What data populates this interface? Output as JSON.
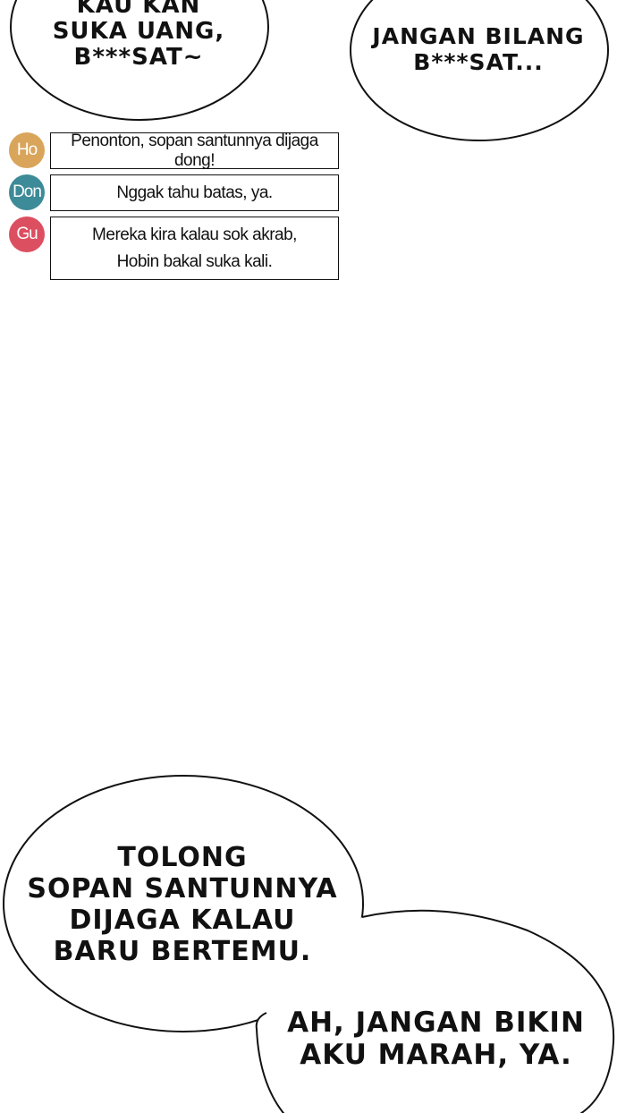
{
  "balloons": {
    "top_left": "KAU KAN\nSUKA UANG,\nB***SAT~",
    "top_right": "JANGAN BILANG\nB***SAT...",
    "bottom_left": "TOLONG\nSOPAN SANTUNNYA\nDIJAGA KALAU\nBARU BERTEMU.",
    "bottom_right": "AH, JANGAN BIKIN\nAKU MARAH, YA."
  },
  "chat": [
    {
      "initials": "Ho",
      "color": "#D9A55B",
      "message": "Penonton, sopan santunnya dijaga dong!"
    },
    {
      "initials": "Don",
      "color": "#3D8A98",
      "message": "Nggak tahu batas, ya."
    },
    {
      "initials": "Gu",
      "color": "#DC4F60",
      "message": "Mereka kira kalau sok akrab,\nHobin bakal suka kali."
    }
  ]
}
